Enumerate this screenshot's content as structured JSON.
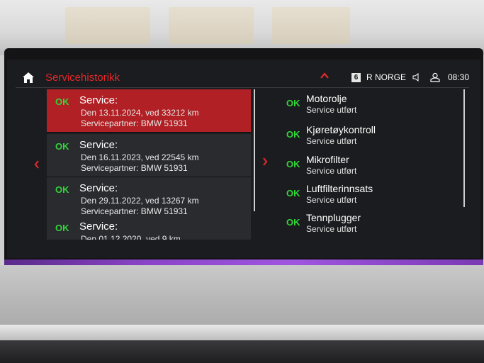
{
  "header": {
    "title": "Servicehistorikk",
    "preset_number": "6",
    "station": "R NORGE",
    "time": "08:30",
    "home_icon": "home-icon",
    "accent_color": "#e0282a"
  },
  "services": [
    {
      "status": "OK",
      "title": "Service:",
      "date_line": "Den 13.11.2024, ved 33212 km",
      "partner_line": "Servicepartner: BMW 51931",
      "selected": true
    },
    {
      "status": "OK",
      "title": "Service:",
      "date_line": "Den 16.11.2023, ved 22545 km",
      "partner_line": "Servicepartner: BMW 51931",
      "selected": false
    },
    {
      "status": "OK",
      "title": "Service:",
      "date_line": "Den 29.11.2022, ved 13267 km",
      "partner_line": "Servicepartner: BMW 51931",
      "selected": false
    },
    {
      "status": "OK",
      "title": "Service:",
      "date_line": "Den 01.12.2020, ved 9 km",
      "partner_line": "",
      "selected": false
    }
  ],
  "details": [
    {
      "status": "OK",
      "name": "Motorolje",
      "state": "Service utført"
    },
    {
      "status": "OK",
      "name": "Kjøretøykontroll",
      "state": "Service utført"
    },
    {
      "status": "OK",
      "name": "Mikrofilter",
      "state": "Service utført"
    },
    {
      "status": "OK",
      "name": "Luftfilterinnsats",
      "state": "Service utført"
    },
    {
      "status": "OK",
      "name": "Tennplugger",
      "state": "Service utført"
    }
  ],
  "colors": {
    "ok_green": "#33d43a",
    "selected_red": "#b02024",
    "ambient_purple": "#8a44c8"
  }
}
